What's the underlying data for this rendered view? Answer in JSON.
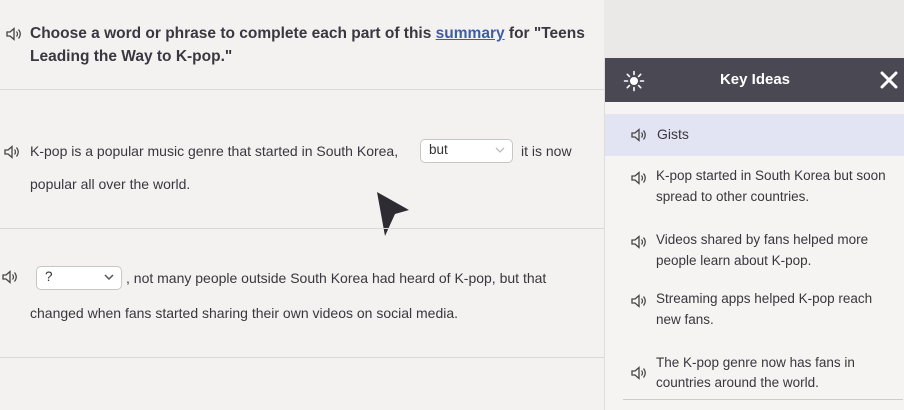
{
  "instruction": {
    "before_link": "Choose a word or phrase to complete each part of this ",
    "link": "summary",
    "after_link": " for \"Teens",
    "line2": "Leading the Way to K-pop.\""
  },
  "sentence1": {
    "before": "K-pop is a popular music genre that started in South Korea,",
    "select_value": "but",
    "after": "it is now",
    "line2": "popular all over the world."
  },
  "sentence2": {
    "select_value": "?",
    "after": ", not many people outside South Korea had heard of K-pop, but that",
    "line2": "changed when fans started sharing their own videos on social media."
  },
  "sidebar": {
    "title": "Key Ideas",
    "section": "Gists",
    "items": [
      {
        "line1": "K-pop started in South Korea but soon",
        "line2": "spread to other countries."
      },
      {
        "line1": "Videos shared by fans helped more",
        "line2": "people learn about K-pop."
      },
      {
        "line1": "Streaming apps helped K-pop reach",
        "line2": "new fans."
      },
      {
        "line1": "The K-pop genre now has fans in",
        "line2": "countries around the world."
      }
    ]
  },
  "colors": {
    "header_bg": "#4a4852",
    "gists_bg": "#e3e4f3",
    "link": "#3e5ca8"
  },
  "icons": [
    "speaker-icon",
    "chevron-down-icon",
    "sun-icon",
    "close-icon",
    "mouse-cursor-icon"
  ]
}
